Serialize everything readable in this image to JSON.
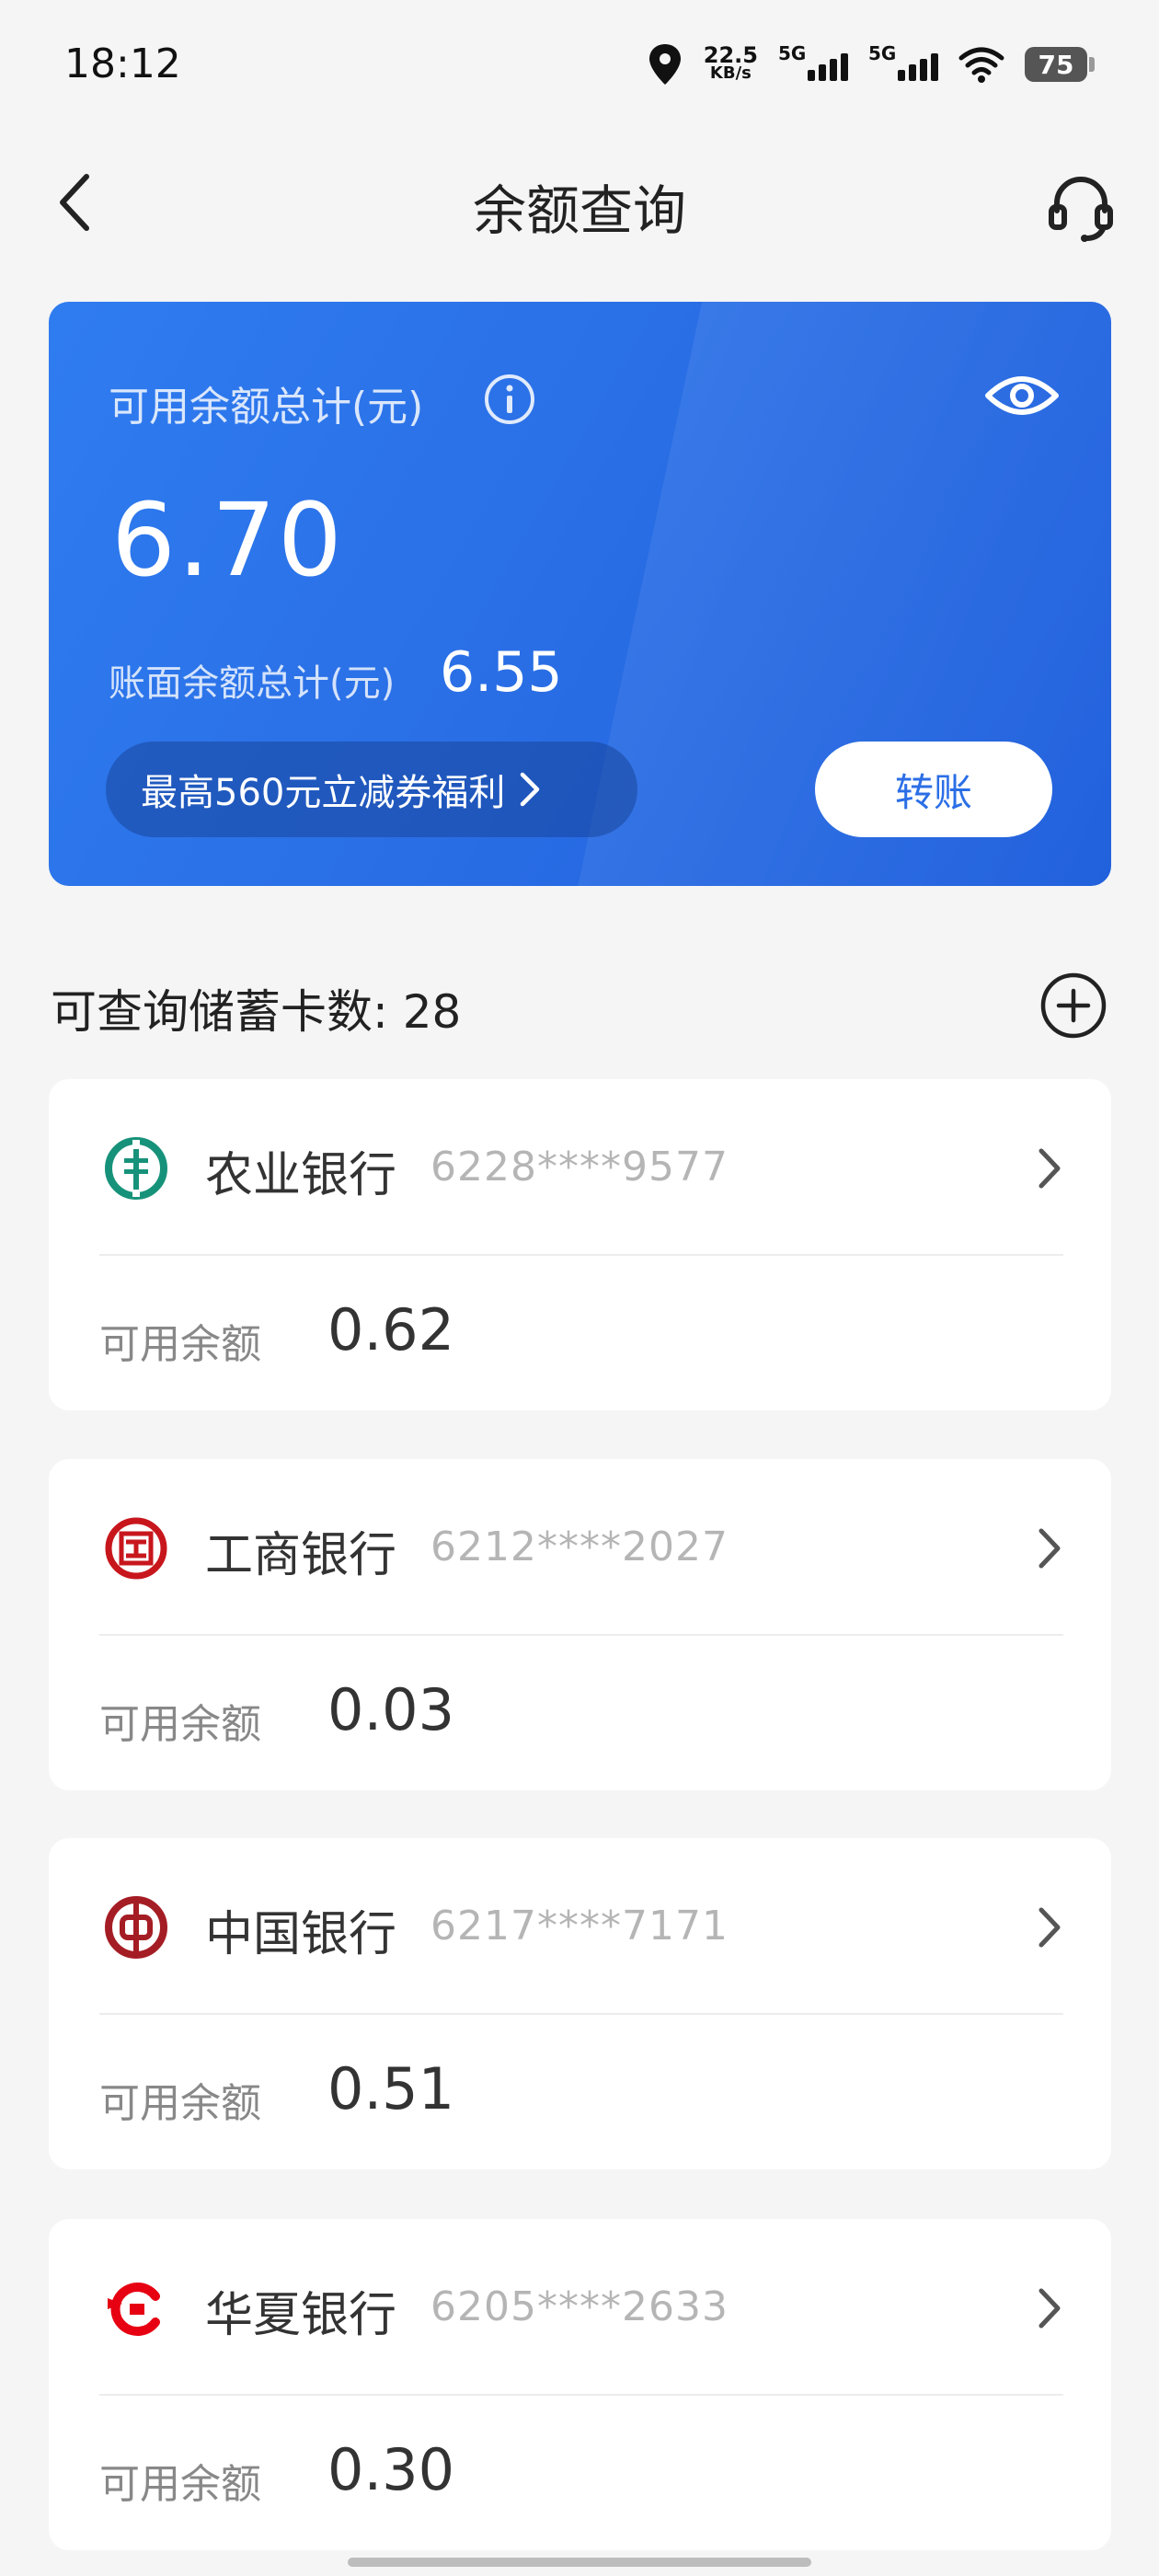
{
  "status_bar": {
    "time": "18:12",
    "speed_value": "22.5",
    "speed_unit": "KB/s",
    "signal1_label": "5G",
    "signal2_label": "5G",
    "battery": "75"
  },
  "header": {
    "title": "余额查询",
    "back_icon": "chevron-left-icon",
    "service_icon": "headset-icon"
  },
  "balance_card": {
    "total_label": "可用余额总计(元)",
    "total_amount": "6.70",
    "book_label": "账面余额总计(元)",
    "book_amount": "6.55",
    "promo_label": "最高560元立减券福利",
    "transfer_label": "转账",
    "colors": {
      "card_bg": "#2a6fe6",
      "transfer_text": "#2b6ee6"
    }
  },
  "cards_section": {
    "title": "可查询储蓄卡数: 28",
    "add_icon": "plus-circle-icon"
  },
  "banks": [
    {
      "name": "农业银行",
      "number": "6228****9577",
      "avail_label": "可用余额",
      "amount": "0.62",
      "logo_icon": "abc-logo-icon",
      "logo_color": "#17927a"
    },
    {
      "name": "工商银行",
      "number": "6212****2027",
      "avail_label": "可用余额",
      "amount": "0.03",
      "logo_icon": "icbc-logo-icon",
      "logo_color": "#c8161d"
    },
    {
      "name": "中国银行",
      "number": "6217****7171",
      "avail_label": "可用余额",
      "amount": "0.51",
      "logo_icon": "boc-logo-icon",
      "logo_color": "#a51d24"
    },
    {
      "name": "华夏银行",
      "number": "6205****2633",
      "avail_label": "可用余额",
      "amount": "0.30",
      "logo_icon": "hxb-logo-icon",
      "logo_color": "#e60012"
    }
  ]
}
